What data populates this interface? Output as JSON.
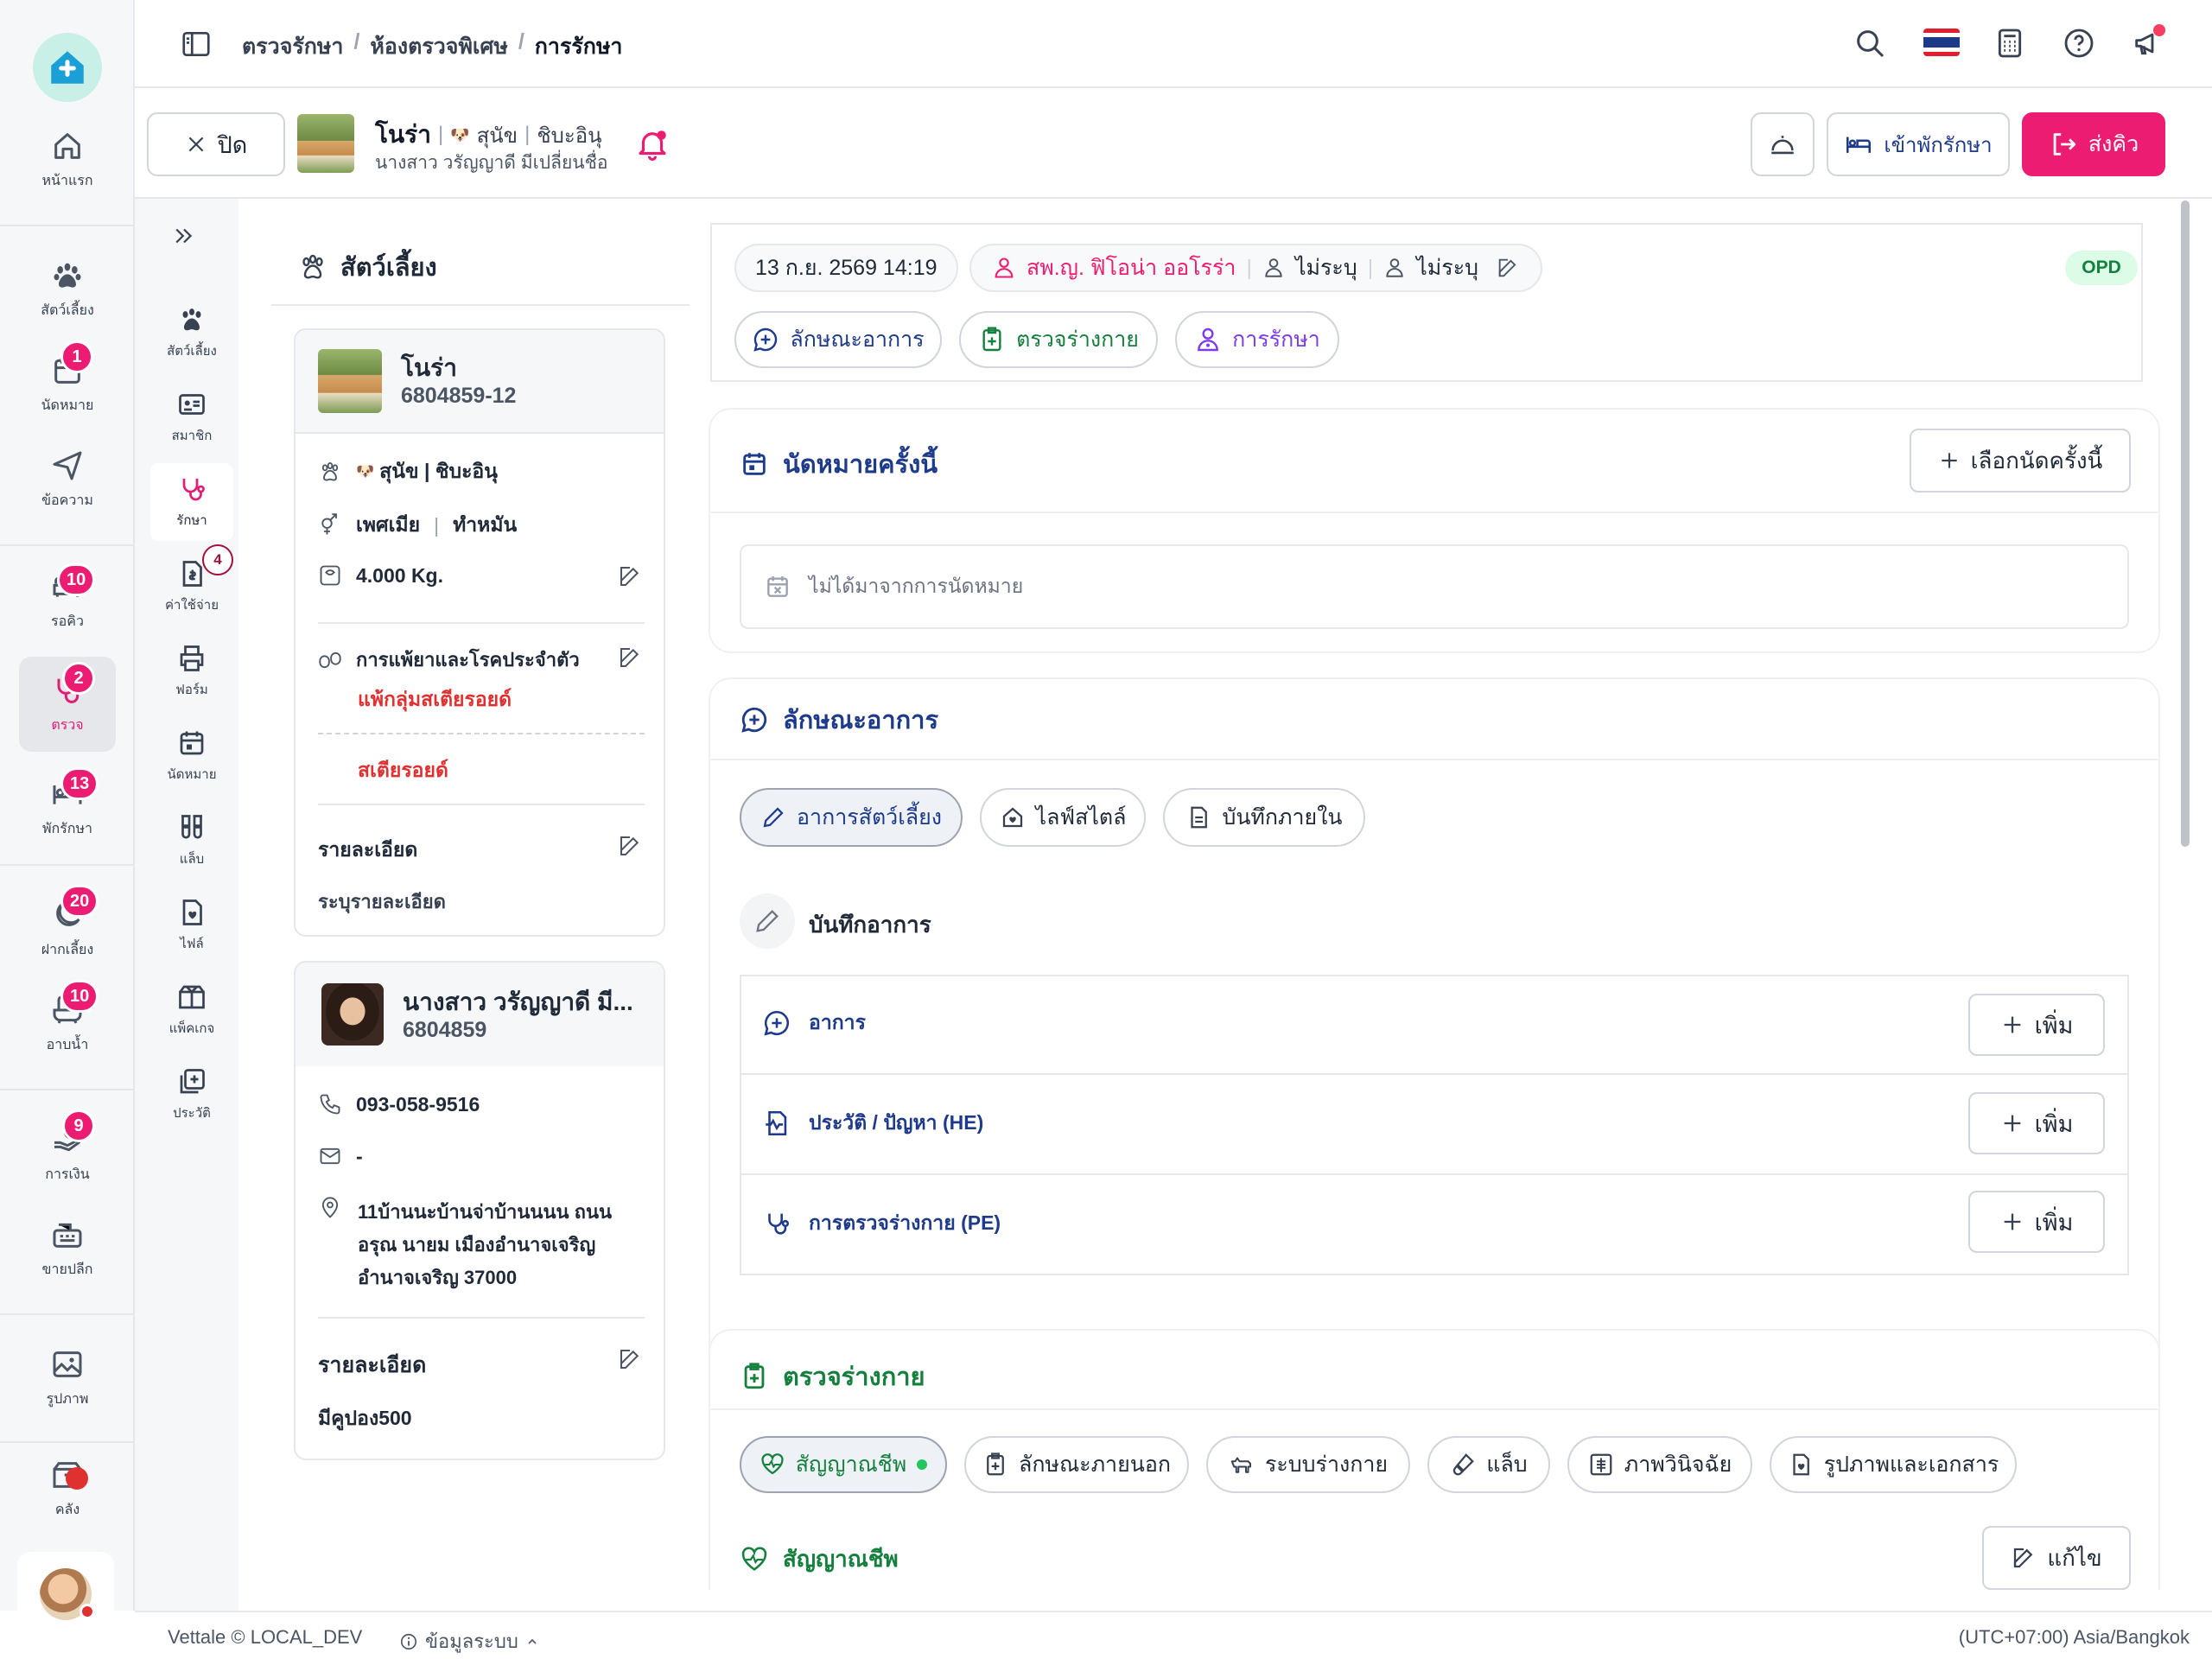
{
  "app": {
    "footer_brand": "Vettale © LOCAL_DEV",
    "footer_info": "ข้อมูลระบบ",
    "footer_tz": "(UTC+07:00) Asia/Bangkok"
  },
  "breadcrumb": [
    "ตรวจรักษา",
    "ห้องตรวจพิเศษ",
    "การรักษา"
  ],
  "rail": [
    {
      "label": "หน้าแรก",
      "icon": "home-icon"
    },
    {
      "label": "สัตว์เลี้ยง",
      "icon": "paw-icon"
    },
    {
      "label": "นัดหมาย",
      "icon": "calendar-icon",
      "badge": "1"
    },
    {
      "label": "ข้อความ",
      "icon": "send-icon"
    },
    {
      "label": "รอคิว",
      "icon": "sofa-icon",
      "badge": "10"
    },
    {
      "label": "ตรวจ",
      "icon": "stethoscope-icon",
      "badge": "2"
    },
    {
      "label": "พักรักษา",
      "icon": "bed-icon",
      "badge": "13"
    },
    {
      "label": "ฝากเลี้ยง",
      "icon": "moon-icon",
      "badge": "20"
    },
    {
      "label": "อาบน้ำ",
      "icon": "bath-icon",
      "badge": "10"
    },
    {
      "label": "การเงิน",
      "icon": "money-hand-icon",
      "badge": "9"
    },
    {
      "label": "ขายปลีก",
      "icon": "cash-register-icon"
    },
    {
      "label": "รูปภาพ",
      "icon": "image-icon"
    },
    {
      "label": "คลัง",
      "icon": "box-icon"
    }
  ],
  "patient": {
    "close_label": "ปิด",
    "name": "โนร่า",
    "species": "สุนัข",
    "breed": "ชิบะอินุ",
    "owner": "นางสาว วรัญญาดี มีเปลี่ยนชื่อ",
    "admit_label": "เข้าพักรักษา",
    "send_label": "ส่งคิว"
  },
  "subrail": [
    {
      "label": "สัตว์เลี้ยง"
    },
    {
      "label": "สมาชิก"
    },
    {
      "label": "รักษา"
    },
    {
      "label": "ค่าใช้จ่าย",
      "badge": "4"
    },
    {
      "label": "ฟอร์ม"
    },
    {
      "label": "นัดหมาย"
    },
    {
      "label": "แล็บ"
    },
    {
      "label": "ไฟล์"
    },
    {
      "label": "แพ็คเกจ"
    },
    {
      "label": "ประวัติ"
    }
  ],
  "pet_panel": {
    "title": "สัตว์เลี้ยง",
    "pet_name": "โนร่า",
    "pet_id": "6804859-12",
    "species_breed": "สุนัข | ชิบะอินุ",
    "sex": "เพศเมีย",
    "neuter": "ทำหมัน",
    "weight": "4.000 Kg.",
    "allergy_title": "การแพ้ยาและโรคประจำตัว",
    "allergy_value": "แพ้กลุ่มสเตียรอยด์",
    "disease_value": "สเตียรอยด์",
    "detail_title": "รายละเอียด",
    "detail_value": "ระบุรายละเอียด",
    "owner_name": "นางสาว วรัญญาดี มี...",
    "owner_id": "6804859",
    "phone": "093-058-9516",
    "email": "-",
    "address": [
      "11บ้านนะบ้านจ่าบ้านนนน ถนน",
      "อรุณ นายม เมืองอำนาจเจริญ",
      "อำนาจเจริญ 37000"
    ],
    "owner_detail_title": "รายละเอียด",
    "owner_detail_value": "มีคูปอง500"
  },
  "visit": {
    "datetime": "13 ก.ย. 2569 14:19",
    "vet": "สพ.ญ. ฟิโอน่า ออโรร่า",
    "assist1": "ไม่ระบุ",
    "assist2": "ไม่ระบุ",
    "type_badge": "OPD",
    "tabs": [
      "ลักษณะอาการ",
      "ตรวจร่างกาย",
      "การรักษา"
    ]
  },
  "appointment": {
    "title": "นัดหมายครั้งนี้",
    "select_label": "เลือกนัดครั้งนี้",
    "empty": "ไม่ได้มาจากการนัดหมาย"
  },
  "symptoms": {
    "title": "ลักษณะอาการ",
    "tabs": [
      "อาการสัตว์เลี้ยง",
      "ไลฟ์สไตล์",
      "บันทึกภายใน"
    ],
    "record_title": "บันทึกอาการ",
    "rows": [
      {
        "label": "อาการ",
        "btn": "เพิ่ม"
      },
      {
        "label": "ประวัติ / ปัญหา (HE)",
        "btn": "เพิ่ม"
      },
      {
        "label": "การตรวจร่างกาย (PE)",
        "btn": "เพิ่ม"
      }
    ]
  },
  "exam": {
    "title": "ตรวจร่างกาย",
    "tabs": [
      "สัญญาณชีพ",
      "ลักษณะภายนอก",
      "ระบบร่างกาย",
      "แล็บ",
      "ภาพวินิจฉัย",
      "รูปภาพและเอกสาร"
    ],
    "vitals_title": "สัญญาณชีพ",
    "edit_label": "แก้ไข"
  },
  "colors": {
    "accent": "#ec1c73",
    "navy": "#1e3a8a",
    "green": "#15803d",
    "purple": "#7c3aed",
    "red": "#e03131"
  }
}
